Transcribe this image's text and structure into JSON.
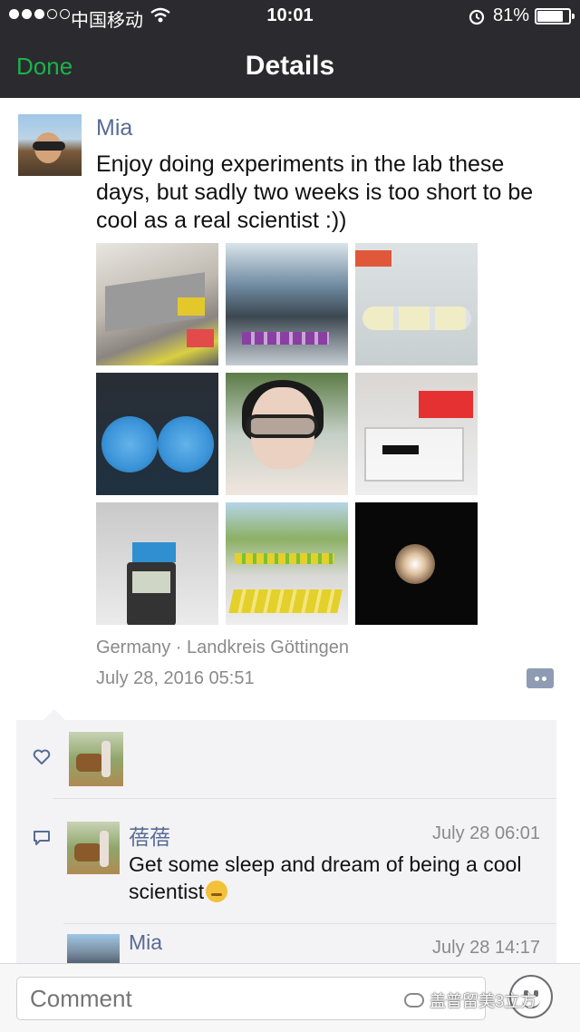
{
  "status_bar": {
    "carrier": "中国移动",
    "time": "10:01",
    "battery": "81%"
  },
  "nav": {
    "done_label": "Done",
    "title": "Details"
  },
  "post": {
    "author": "Mia",
    "text": "Enjoy doing experiments in the lab these days, but sadly two weeks is too short to be cool as a real scientist :))",
    "photo_count": 9,
    "location": "Germany · Landkreis Göttingen",
    "timestamp": "July 28, 2016 05:51"
  },
  "comments": [
    {
      "name": "蓓蓓",
      "time": "July 28 06:01",
      "text": "Get some sleep and dream of being a cool scientist"
    },
    {
      "name": "Mia",
      "time": "July 28 14:17"
    }
  ],
  "comment_bar": {
    "placeholder": "Comment"
  },
  "watermark": "盖普留美3立方",
  "icons": {
    "wifi": "wifi-icon",
    "alarm": "alarm-icon",
    "like": "heart-icon",
    "comment": "comment-icon",
    "more": "more-icon",
    "emoji": "emoji-icon"
  },
  "colors": {
    "nav_bg": "#2b2b2f",
    "done_green": "#1ab34a",
    "link_blue": "#576b95",
    "meta_gray": "#8a8a8a",
    "comment_bg": "#f3f3f5"
  }
}
